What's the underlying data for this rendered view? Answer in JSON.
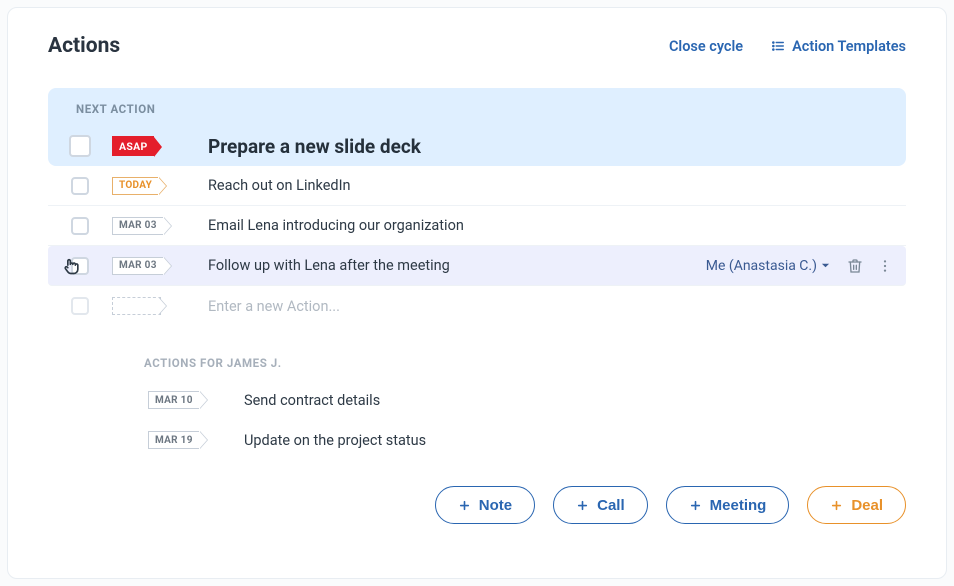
{
  "header": {
    "title": "Actions",
    "close_cycle": "Close cycle",
    "templates": "Action Templates"
  },
  "next_action": {
    "label": "NEXT ACTION",
    "priority": "ASAP",
    "title": "Prepare a new slide deck"
  },
  "actions": [
    {
      "date": "TODAY",
      "date_style": "today",
      "title": "Reach out on LinkedIn"
    },
    {
      "date": "MAR 03",
      "date_style": "plain",
      "title": "Email Lena introducing our organization"
    },
    {
      "date": "MAR 03",
      "date_style": "plain",
      "title": "Follow up with Lena after the meeting",
      "assignee": "Me (Anastasia C.)",
      "active": true
    }
  ],
  "new_action_placeholder": "Enter a new Action...",
  "section2": {
    "label": "ACTIONS FOR JAMES J.",
    "items": [
      {
        "date": "MAR 10",
        "title": "Send contract details"
      },
      {
        "date": "MAR 19",
        "title": "Update on the project status"
      }
    ]
  },
  "footer": {
    "note": "Note",
    "call": "Call",
    "meeting": "Meeting",
    "deal": "Deal"
  }
}
